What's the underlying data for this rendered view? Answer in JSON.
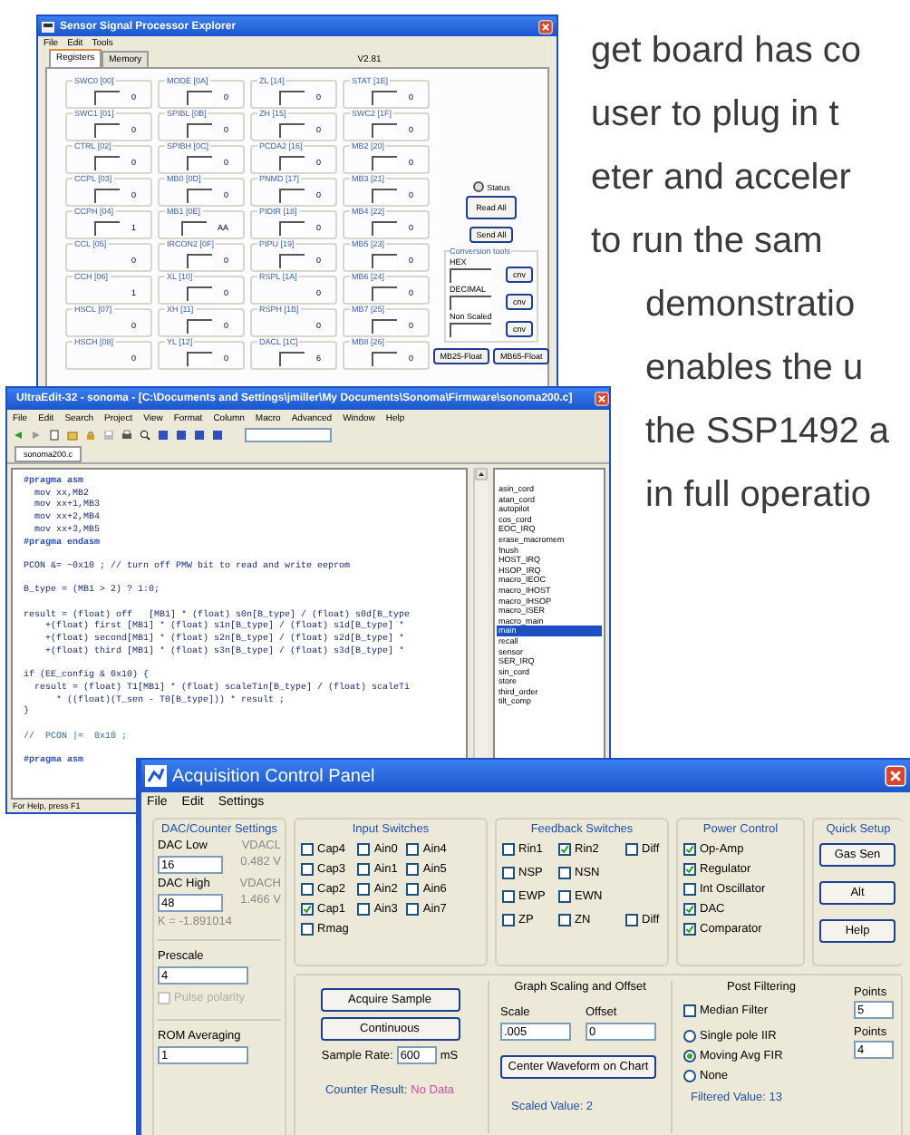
{
  "page_text": [
    "get board has co",
    "user to plug in t",
    "eter and acceler",
    "to run the sam",
    "demonstratio",
    "enables the u",
    "the SSP1492 a",
    "in full operatio"
  ],
  "explorer": {
    "title": "Sensor Signal Processor Explorer",
    "menu": [
      "File",
      "Edit",
      "Tools"
    ],
    "tabs": [
      {
        "label": "Registers",
        "selected": true
      },
      {
        "label": "Memory",
        "selected": false
      }
    ],
    "version": "V2.81",
    "registers": [
      {
        "name": "SWC0 [00]",
        "value": "0",
        "editable": true
      },
      {
        "name": "MODE [0A]",
        "value": "0",
        "editable": true
      },
      {
        "name": "ZL [14]",
        "value": "0",
        "editable": true
      },
      {
        "name": "STAT [1E]",
        "value": "0",
        "editable": true
      },
      {
        "name": "SWC1 [01]",
        "value": "0",
        "editable": true
      },
      {
        "name": "SPIBL [0B]",
        "value": "0",
        "editable": true
      },
      {
        "name": "ZH [15]",
        "value": "0",
        "editable": true
      },
      {
        "name": "SWC2 [1F]",
        "value": "0",
        "editable": true
      },
      {
        "name": "CTRL [02]",
        "value": "0",
        "editable": true
      },
      {
        "name": "SPIBH [0C]",
        "value": "0",
        "editable": true
      },
      {
        "name": "PCDA2 [16]",
        "value": "0",
        "editable": true
      },
      {
        "name": "MB2 [20]",
        "value": "0",
        "editable": true
      },
      {
        "name": "CCPL [03]",
        "value": "0",
        "editable": true
      },
      {
        "name": "MB0 [0D]",
        "value": "0",
        "editable": true
      },
      {
        "name": "PNMD [17]",
        "value": "0",
        "editable": true
      },
      {
        "name": "MB3 [21]",
        "value": "0",
        "editable": true
      },
      {
        "name": "CCPH [04]",
        "value": "1",
        "editable": true
      },
      {
        "name": "MB1 [0E]",
        "value": "AA",
        "editable": true
      },
      {
        "name": "PIDIR [18]",
        "value": "0",
        "editable": true
      },
      {
        "name": "MB4 [22]",
        "value": "0",
        "editable": true
      },
      {
        "name": "CCL [05]",
        "value": "0",
        "editable": false
      },
      {
        "name": "IRCON2 [0F]",
        "value": "0",
        "editable": true
      },
      {
        "name": "PIPU [19]",
        "value": "0",
        "editable": true
      },
      {
        "name": "MB5 [23]",
        "value": "0",
        "editable": true
      },
      {
        "name": "CCH [06]",
        "value": "1",
        "editable": false
      },
      {
        "name": "XL [10]",
        "value": "0",
        "editable": true
      },
      {
        "name": "RSPL [1A]",
        "value": "0",
        "editable": false
      },
      {
        "name": "MB6 [24]",
        "value": "0",
        "editable": true
      },
      {
        "name": "HSCL [07]",
        "value": "0",
        "editable": false
      },
      {
        "name": "XH [11]",
        "value": "0",
        "editable": true
      },
      {
        "name": "RSPH [1B]",
        "value": "0",
        "editable": false
      },
      {
        "name": "MB7 [25]",
        "value": "0",
        "editable": true
      },
      {
        "name": "HSCH [08]",
        "value": "0",
        "editable": false
      },
      {
        "name": "YL [12]",
        "value": "0",
        "editable": true
      },
      {
        "name": "DACL [1C]",
        "value": "6",
        "editable": true
      },
      {
        "name": "MB8 [26]",
        "value": "0",
        "editable": true
      }
    ],
    "status_label": "Status",
    "buttons": [
      "Read All",
      "Send All"
    ],
    "conversion": {
      "title": "Conversion tools",
      "rows": [
        {
          "label": "HEX",
          "button": "cnv"
        },
        {
          "label": "DECIMAL",
          "button": "cnv"
        },
        {
          "label": "Non Scaled",
          "button": "cnv"
        }
      ]
    },
    "float_buttons": [
      "MB25-Float",
      "MB65-Float"
    ]
  },
  "editor": {
    "title": "UltraEdit-32 - sonoma - [C:\\Documents and Settings\\jmiller\\My Documents\\Sonoma\\Firmware\\sonoma200.c]",
    "menu": [
      "File",
      "Edit",
      "Search",
      "Project",
      "View",
      "Format",
      "Column",
      "Macro",
      "Advanced",
      "Window",
      "Help"
    ],
    "tab": "sonoma200.c",
    "code": [
      {
        "kind": "directive",
        "text": "#pragma asm"
      },
      {
        "kind": "code",
        "text": "  mov xx,MB2"
      },
      {
        "kind": "code",
        "text": "  mov xx+1,MB3"
      },
      {
        "kind": "code",
        "text": "  mov xx+2,MB4"
      },
      {
        "kind": "code",
        "text": "  mov xx+3,MB5"
      },
      {
        "kind": "directive",
        "text": "#pragma endasm"
      },
      {
        "kind": "blank"
      },
      {
        "kind": "code",
        "text": "PCON &= ~0x10 ; // turn off PMW bit to read and write eeprom"
      },
      {
        "kind": "blank"
      },
      {
        "kind": "code",
        "text": "B_type = (MB1 > 2) ? 1:0;"
      },
      {
        "kind": "blank"
      },
      {
        "kind": "code",
        "text": "result = (float) off   [MB1] * (float) s0n[B_type] / (float) s0d[B_type"
      },
      {
        "kind": "code",
        "text": "    +(float) first [MB1] * (float) s1n[B_type] / (float) s1d[B_type] *"
      },
      {
        "kind": "code",
        "text": "    +(float) second[MB1] * (float) s2n[B_type] / (float) s2d[B_type] *"
      },
      {
        "kind": "code",
        "text": "    +(float) third [MB1] * (float) s3n[B_type] / (float) s3d[B_type] *"
      },
      {
        "kind": "blank"
      },
      {
        "kind": "code",
        "text": "if (EE_config & 0x10) {"
      },
      {
        "kind": "code",
        "text": "  result = (float) T1[MB1] * (float) scaleTin[B_type] / (float) scaleTi"
      },
      {
        "kind": "code",
        "text": "      * ((float)(T_sen - T0[B_type])) * result ;"
      },
      {
        "kind": "code",
        "text": "}"
      },
      {
        "kind": "blank"
      },
      {
        "kind": "comment",
        "text": "//  PCON |=  0x10 ;"
      },
      {
        "kind": "blank"
      },
      {
        "kind": "directive",
        "text": "#pragma asm"
      }
    ],
    "functions": [
      {
        "name": "asin_cord",
        "selected": false
      },
      {
        "name": "atan_cord",
        "selected": false
      },
      {
        "name": "autopilot",
        "selected": false
      },
      {
        "name": "cos_cord",
        "selected": false
      },
      {
        "name": "EOC_IRQ",
        "selected": false
      },
      {
        "name": "erase_macromem",
        "selected": false
      },
      {
        "name": "fnush",
        "selected": false
      },
      {
        "name": "HOST_IRQ",
        "selected": false
      },
      {
        "name": "HSOP_IRQ",
        "selected": false
      },
      {
        "name": "macro_IEOC",
        "selected": false
      },
      {
        "name": "macro_IHOST",
        "selected": false
      },
      {
        "name": "macro_IHSOP",
        "selected": false
      },
      {
        "name": "macro_ISER",
        "selected": false
      },
      {
        "name": "macro_main",
        "selected": false
      },
      {
        "name": "main",
        "selected": true
      },
      {
        "name": "recall",
        "selected": false
      },
      {
        "name": "sensor",
        "selected": false
      },
      {
        "name": "SER_IRQ",
        "selected": false
      },
      {
        "name": "sin_cord",
        "selected": false
      },
      {
        "name": "store",
        "selected": false
      },
      {
        "name": "third_order",
        "selected": false
      },
      {
        "name": "tilt_comp",
        "selected": false
      }
    ],
    "status": "For Help, press F1"
  },
  "acquisition": {
    "title": "Acquisition Control Panel",
    "menu": [
      "File",
      "Edit",
      "Settings"
    ],
    "dac": {
      "title": "DAC/Counter Settings",
      "low_label": "DAC Low",
      "low_value": "16",
      "vlow_label": "VDACL",
      "vlow_value": "0.482 V",
      "high_label": "DAC High",
      "high_value": "48",
      "vhigh_label": "VDACH",
      "vhigh_value": "1.466 V",
      "k_text": "K = -1.891014"
    },
    "prescale": {
      "label": "Prescale",
      "value": "4"
    },
    "pulse_polarity": {
      "label": "Pulse polarity",
      "checked": false,
      "disabled": true
    },
    "rom_averaging": {
      "label": "ROM Averaging",
      "value": "1"
    },
    "input_switches": {
      "title": "Input Switches",
      "columns": [
        [
          {
            "label": "Cap4",
            "checked": false
          },
          {
            "label": "Cap3",
            "checked": false
          },
          {
            "label": "Cap2",
            "checked": false
          },
          {
            "label": "Cap1",
            "checked": true
          },
          {
            "label": "Rmag",
            "checked": false
          }
        ],
        [
          {
            "label": "Ain0",
            "checked": false
          },
          {
            "label": "Ain1",
            "checked": false
          },
          {
            "label": "Ain2",
            "checked": false
          },
          {
            "label": "Ain3",
            "checked": false
          }
        ],
        [
          {
            "label": "Ain4",
            "checked": false
          },
          {
            "label": "Ain5",
            "checked": false
          },
          {
            "label": "Ain6",
            "checked": false
          },
          {
            "label": "Ain7",
            "checked": false
          }
        ]
      ]
    },
    "feedback_switches": {
      "title": "Feedback Switches",
      "rows": [
        [
          {
            "label": "Rin1",
            "checked": false
          },
          {
            "label": "Rin2",
            "checked": true
          },
          {
            "label": "Diff",
            "checked": false
          }
        ],
        [
          {
            "label": "NSP",
            "checked": false
          },
          {
            "label": "NSN",
            "checked": false
          }
        ],
        [
          {
            "label": "EWP",
            "checked": false
          },
          {
            "label": "EWN",
            "checked": false
          }
        ],
        [
          {
            "label": "ZP",
            "checked": false
          },
          {
            "label": "ZN",
            "checked": false
          },
          {
            "label": "Diff",
            "checked": false
          }
        ]
      ]
    },
    "power_control": {
      "title": "Power Control",
      "items": [
        {
          "label": "Op-Amp",
          "checked": true
        },
        {
          "label": "Regulator",
          "checked": true
        },
        {
          "label": "Int Oscillator",
          "checked": false
        },
        {
          "label": "DAC",
          "checked": true
        },
        {
          "label": "Comparator",
          "checked": true
        }
      ]
    },
    "quick_setup": {
      "title": "Quick Setup",
      "buttons": [
        "Gas Sen",
        "Alt",
        "Help"
      ]
    },
    "acquire": {
      "buttons": [
        "Acquire Sample",
        "Continuous"
      ],
      "rate_label": "Sample Rate:",
      "rate_value": "600",
      "rate_unit": "mS",
      "counter_label": "Counter Result:",
      "counter_value": "No Data"
    },
    "scaling": {
      "title": "Graph Scaling and Offset",
      "scale_label": "Scale",
      "scale_value": ".005",
      "offset_label": "Offset",
      "offset_value": "0",
      "button": "Center Waveform on Chart",
      "scaled_value": "Scaled Value: 2"
    },
    "filtering": {
      "title": "Post Filtering",
      "median": {
        "label": "Median Filter",
        "checked": false
      },
      "points_label": "Points",
      "points_value": "5",
      "modes": [
        {
          "label": "Single pole IIR",
          "selected": false
        },
        {
          "label": "Moving Avg FIR",
          "selected": true
        },
        {
          "label": "None",
          "selected": false
        }
      ],
      "points2_label": "Points",
      "points2_value": "4",
      "filtered_value": "Filtered Value: 13"
    }
  }
}
